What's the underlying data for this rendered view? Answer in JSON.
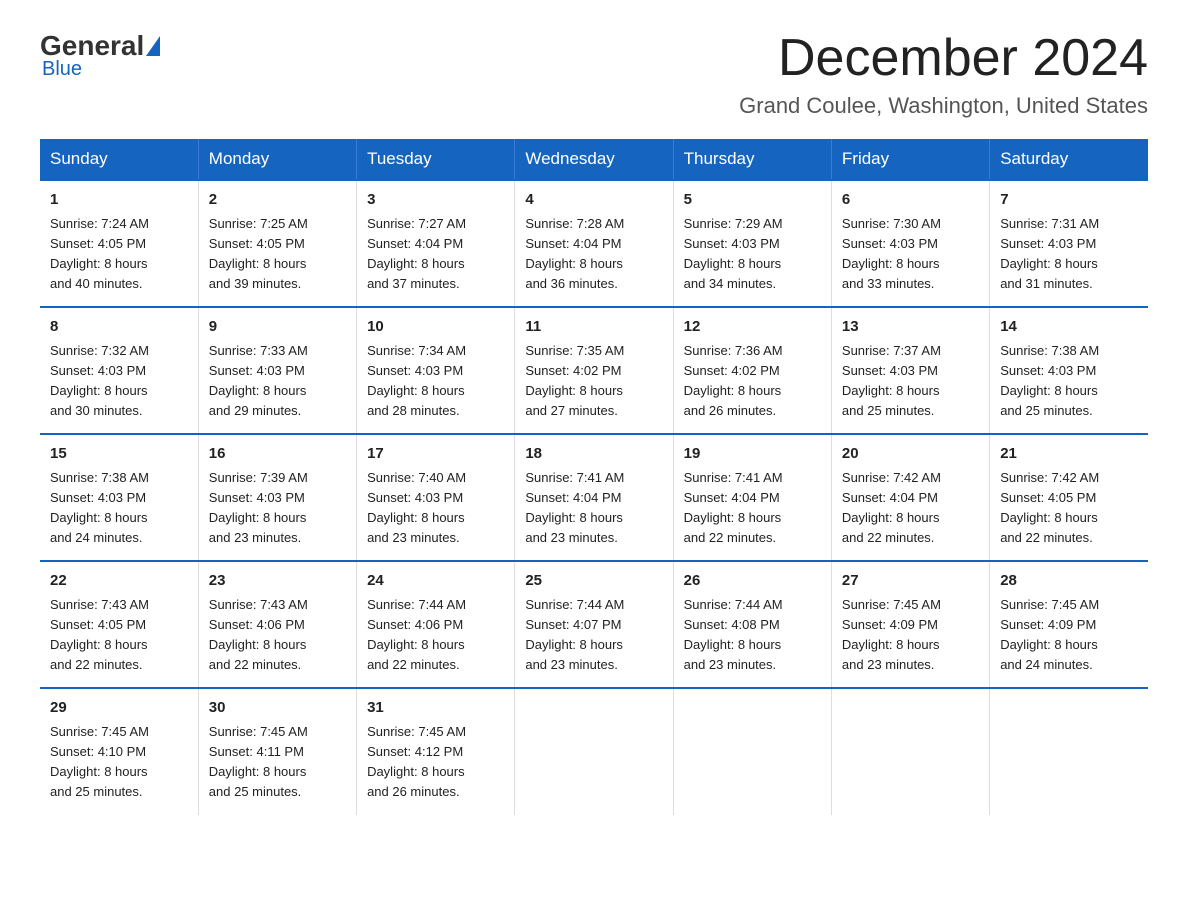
{
  "logo": {
    "general": "General",
    "blue": "Blue"
  },
  "title": "December 2024",
  "subtitle": "Grand Coulee, Washington, United States",
  "days_of_week": [
    "Sunday",
    "Monday",
    "Tuesday",
    "Wednesday",
    "Thursday",
    "Friday",
    "Saturday"
  ],
  "weeks": [
    [
      {
        "day": "1",
        "info": "Sunrise: 7:24 AM\nSunset: 4:05 PM\nDaylight: 8 hours\nand 40 minutes."
      },
      {
        "day": "2",
        "info": "Sunrise: 7:25 AM\nSunset: 4:05 PM\nDaylight: 8 hours\nand 39 minutes."
      },
      {
        "day": "3",
        "info": "Sunrise: 7:27 AM\nSunset: 4:04 PM\nDaylight: 8 hours\nand 37 minutes."
      },
      {
        "day": "4",
        "info": "Sunrise: 7:28 AM\nSunset: 4:04 PM\nDaylight: 8 hours\nand 36 minutes."
      },
      {
        "day": "5",
        "info": "Sunrise: 7:29 AM\nSunset: 4:03 PM\nDaylight: 8 hours\nand 34 minutes."
      },
      {
        "day": "6",
        "info": "Sunrise: 7:30 AM\nSunset: 4:03 PM\nDaylight: 8 hours\nand 33 minutes."
      },
      {
        "day": "7",
        "info": "Sunrise: 7:31 AM\nSunset: 4:03 PM\nDaylight: 8 hours\nand 31 minutes."
      }
    ],
    [
      {
        "day": "8",
        "info": "Sunrise: 7:32 AM\nSunset: 4:03 PM\nDaylight: 8 hours\nand 30 minutes."
      },
      {
        "day": "9",
        "info": "Sunrise: 7:33 AM\nSunset: 4:03 PM\nDaylight: 8 hours\nand 29 minutes."
      },
      {
        "day": "10",
        "info": "Sunrise: 7:34 AM\nSunset: 4:03 PM\nDaylight: 8 hours\nand 28 minutes."
      },
      {
        "day": "11",
        "info": "Sunrise: 7:35 AM\nSunset: 4:02 PM\nDaylight: 8 hours\nand 27 minutes."
      },
      {
        "day": "12",
        "info": "Sunrise: 7:36 AM\nSunset: 4:02 PM\nDaylight: 8 hours\nand 26 minutes."
      },
      {
        "day": "13",
        "info": "Sunrise: 7:37 AM\nSunset: 4:03 PM\nDaylight: 8 hours\nand 25 minutes."
      },
      {
        "day": "14",
        "info": "Sunrise: 7:38 AM\nSunset: 4:03 PM\nDaylight: 8 hours\nand 25 minutes."
      }
    ],
    [
      {
        "day": "15",
        "info": "Sunrise: 7:38 AM\nSunset: 4:03 PM\nDaylight: 8 hours\nand 24 minutes."
      },
      {
        "day": "16",
        "info": "Sunrise: 7:39 AM\nSunset: 4:03 PM\nDaylight: 8 hours\nand 23 minutes."
      },
      {
        "day": "17",
        "info": "Sunrise: 7:40 AM\nSunset: 4:03 PM\nDaylight: 8 hours\nand 23 minutes."
      },
      {
        "day": "18",
        "info": "Sunrise: 7:41 AM\nSunset: 4:04 PM\nDaylight: 8 hours\nand 23 minutes."
      },
      {
        "day": "19",
        "info": "Sunrise: 7:41 AM\nSunset: 4:04 PM\nDaylight: 8 hours\nand 22 minutes."
      },
      {
        "day": "20",
        "info": "Sunrise: 7:42 AM\nSunset: 4:04 PM\nDaylight: 8 hours\nand 22 minutes."
      },
      {
        "day": "21",
        "info": "Sunrise: 7:42 AM\nSunset: 4:05 PM\nDaylight: 8 hours\nand 22 minutes."
      }
    ],
    [
      {
        "day": "22",
        "info": "Sunrise: 7:43 AM\nSunset: 4:05 PM\nDaylight: 8 hours\nand 22 minutes."
      },
      {
        "day": "23",
        "info": "Sunrise: 7:43 AM\nSunset: 4:06 PM\nDaylight: 8 hours\nand 22 minutes."
      },
      {
        "day": "24",
        "info": "Sunrise: 7:44 AM\nSunset: 4:06 PM\nDaylight: 8 hours\nand 22 minutes."
      },
      {
        "day": "25",
        "info": "Sunrise: 7:44 AM\nSunset: 4:07 PM\nDaylight: 8 hours\nand 23 minutes."
      },
      {
        "day": "26",
        "info": "Sunrise: 7:44 AM\nSunset: 4:08 PM\nDaylight: 8 hours\nand 23 minutes."
      },
      {
        "day": "27",
        "info": "Sunrise: 7:45 AM\nSunset: 4:09 PM\nDaylight: 8 hours\nand 23 minutes."
      },
      {
        "day": "28",
        "info": "Sunrise: 7:45 AM\nSunset: 4:09 PM\nDaylight: 8 hours\nand 24 minutes."
      }
    ],
    [
      {
        "day": "29",
        "info": "Sunrise: 7:45 AM\nSunset: 4:10 PM\nDaylight: 8 hours\nand 25 minutes."
      },
      {
        "day": "30",
        "info": "Sunrise: 7:45 AM\nSunset: 4:11 PM\nDaylight: 8 hours\nand 25 minutes."
      },
      {
        "day": "31",
        "info": "Sunrise: 7:45 AM\nSunset: 4:12 PM\nDaylight: 8 hours\nand 26 minutes."
      },
      {
        "day": "",
        "info": ""
      },
      {
        "day": "",
        "info": ""
      },
      {
        "day": "",
        "info": ""
      },
      {
        "day": "",
        "info": ""
      }
    ]
  ]
}
